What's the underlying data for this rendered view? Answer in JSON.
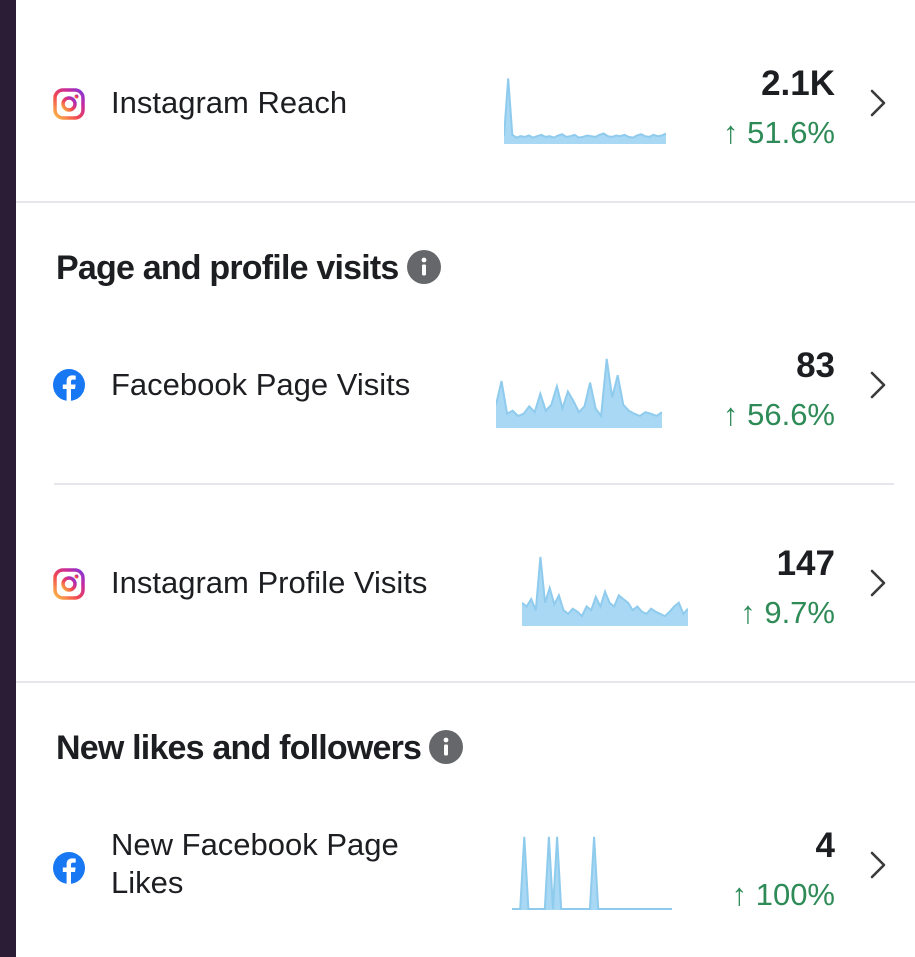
{
  "rows": {
    "instagram_reach": {
      "label": "Instagram Reach",
      "icon": "instagram-icon",
      "value": "2.1K",
      "change": "↑ 51.6%",
      "trend": [
        10,
        95,
        12,
        8,
        10,
        9,
        11,
        8,
        10,
        12,
        9,
        10,
        8,
        11,
        13,
        9,
        10,
        12,
        8,
        9,
        11,
        10,
        9,
        12,
        14,
        10,
        9,
        11,
        10,
        12,
        9,
        8,
        11,
        13,
        10,
        9,
        12,
        10,
        11,
        14
      ]
    },
    "facebook_page_visits": {
      "label": "Facebook Page Visits",
      "icon": "facebook-icon",
      "value": "83",
      "change": "↑ 56.6%",
      "trend": [
        30,
        62,
        18,
        22,
        15,
        18,
        28,
        20,
        45,
        22,
        30,
        55,
        25,
        48,
        35,
        20,
        28,
        60,
        25,
        15,
        92,
        40,
        70,
        30,
        22,
        18,
        15,
        20,
        18,
        15,
        20
      ]
    },
    "instagram_profile_visits": {
      "label": "Instagram Profile Visits",
      "icon": "instagram-icon",
      "value": "147",
      "change": "↑ 9.7%",
      "trend": [
        30,
        25,
        35,
        20,
        92,
        30,
        50,
        28,
        40,
        20,
        15,
        22,
        18,
        12,
        25,
        20,
        38,
        25,
        45,
        30,
        25,
        40,
        35,
        30,
        20,
        25,
        18,
        15,
        22,
        18,
        15,
        12,
        18,
        25,
        30,
        15,
        22
      ]
    },
    "new_facebook_page_likes": {
      "label": "New Facebook Page Likes",
      "icon": "facebook-icon",
      "value": "4",
      "change": "↑ 100%",
      "trend": [
        0,
        0,
        0,
        95,
        0,
        0,
        0,
        0,
        0,
        95,
        0,
        95,
        0,
        0,
        0,
        0,
        0,
        0,
        0,
        0,
        95,
        0,
        0,
        0,
        0,
        0,
        0,
        0,
        0,
        0,
        0,
        0,
        0,
        0,
        0,
        0,
        0,
        0,
        0,
        0
      ]
    }
  },
  "sections": {
    "page_profile_visits": {
      "title": "Page and profile visits"
    },
    "new_likes_followers": {
      "title": "New likes and followers"
    }
  },
  "colors": {
    "trend_fill": "#a8d8f4",
    "trend_line": "#8fcbed",
    "positive_change": "#2e8b57",
    "facebook_blue": "#1877f2",
    "info_gray": "#65676b"
  }
}
